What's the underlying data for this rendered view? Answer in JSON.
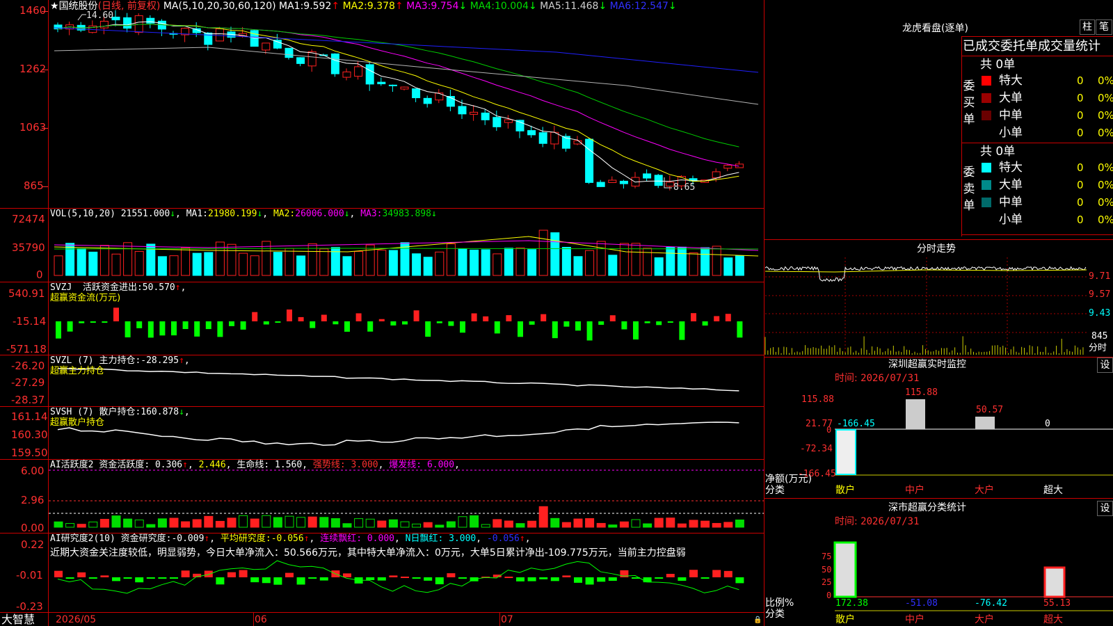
{
  "colors": {
    "up": "#ff0000",
    "down": "#00ffff",
    "ma1": "#ffffff",
    "ma2": "#ffff00",
    "ma3": "#ff00ff",
    "ma4": "#00cc00",
    "ma5": "#b4b4b4",
    "ma6": "#2020ff",
    "grid": "#cc0000",
    "axis": "#ff3030",
    "neutral": "#e0e0e0",
    "lightgreen": "#ff0000"
  },
  "header": {
    "star": "★",
    "stock": "国统股份",
    "period": "(日线, 前复权)",
    "ma_label": "MA(5,10,20,30,60,120)",
    "ma": [
      {
        "name": "MA1:",
        "value": "9.592",
        "arrow": "↑"
      },
      {
        "name": "MA2:",
        "value": "9.378",
        "arrow": "↑"
      },
      {
        "name": "MA3:",
        "value": "9.754",
        "arrow": "↓"
      },
      {
        "name": "MA4:",
        "value": "10.004",
        "arrow": "↓"
      },
      {
        "name": "MA5:",
        "value": "11.468",
        "arrow": "↓"
      },
      {
        "name": "MA6:",
        "value": "12.547",
        "arrow": "↓"
      }
    ]
  },
  "price_axis": [
    "1460",
    "1262",
    "1063",
    "865"
  ],
  "price_marks": {
    "high": "14.60",
    "low": "8.65"
  },
  "vol": {
    "label": "VOL(5,10,20)",
    "value": "21551.000",
    "arrow": "↓",
    "ma": [
      {
        "name": "MA1:",
        "value": "21980.199",
        "arrow": "↓"
      },
      {
        "name": "MA2:",
        "value": "26006.000",
        "arrow": "↓"
      },
      {
        "name": "MA3:",
        "value": "34983.898",
        "arrow": "↓"
      }
    ],
    "axis": [
      "72474",
      "35790",
      "0"
    ]
  },
  "svzj": {
    "label": "SVZJ",
    "name": "活跃资金进出:",
    "value": "50.570",
    "arrow": "↑",
    "sub": "超赢资金流(万元)",
    "axis": [
      "540.91",
      "-15.14",
      "-571.18"
    ]
  },
  "svzl": {
    "label": "SVZL (7)",
    "name": "主力持仓:",
    "value": "-28.295",
    "arrow": "↑",
    "sub": "超赢主力持仓",
    "axis": [
      "-26.20",
      "-27.29",
      "-28.37"
    ]
  },
  "svsh": {
    "label": "SVSH (7)",
    "name": "散户持仓:",
    "value": "160.878",
    "arrow": "↓",
    "sub": "超赢散户持仓",
    "axis": [
      "161.14",
      "160.30",
      "159.50"
    ]
  },
  "ai1": {
    "label": "AI活跃度2",
    "name": "资金活跃度:",
    "value": "0.306",
    "arrow": "↑",
    "v2": "2.446",
    "life": "生命线:",
    "lifev": "1.560",
    "strong": "强势线:",
    "strongv": "3.000",
    "burst": "爆发线:",
    "burstv": "6.000",
    "axis": [
      "6.00",
      "2.96",
      "0.00"
    ]
  },
  "ai2": {
    "label": "AI研究度2(10)",
    "name": "资金研究度:",
    "value": "-0.009",
    "arrow": "↑",
    "avg": "平均研究度:",
    "avgv": "-0.056",
    "arrow2": "↑",
    "red": "连续飘红:",
    "redv": "0.000",
    "nred": "N日飘红:",
    "nredv": "3.000",
    "last": "-0.056",
    "arrow3": "↑",
    "comment": "近期大资金关注度较低，明显弱势，今日大单净流入：50.566万元，其中特大单净流入：0万元，大单5日累计净出-109.775万元，当前主力控盘弱",
    "axis": [
      "0.22",
      "-0.01",
      "-0.23"
    ]
  },
  "footer": {
    "brand": "大智慧",
    "dates": [
      "2026/05",
      "06",
      "07"
    ]
  },
  "right": {
    "lhb_title": "龙虎看盘(逐单)",
    "btn1": "柱",
    "btn2": "笔",
    "tabs": [
      "已成交",
      "委托单",
      "成交量统计"
    ],
    "buy": {
      "label": "委\n买\n单",
      "total": "共 0单",
      "rows": [
        {
          "n": "特大",
          "v": "0",
          "p": "0%",
          "c": "#ff0000"
        },
        {
          "n": "大单",
          "v": "0",
          "p": "0%",
          "c": "#9a0000"
        },
        {
          "n": "中单",
          "v": "0",
          "p": "0%",
          "c": "#6a0000"
        },
        {
          "n": "小单",
          "v": "0",
          "p": "0%",
          "c": "#000000"
        }
      ]
    },
    "sell": {
      "label": "委\n卖\n单",
      "total": "共 0单",
      "rows": [
        {
          "n": "特大",
          "v": "0",
          "p": "0%",
          "c": "#00ffff"
        },
        {
          "n": "大单",
          "v": "0",
          "p": "0%",
          "c": "#008a8a"
        },
        {
          "n": "中单",
          "v": "0",
          "p": "0%",
          "c": "#006a6a"
        },
        {
          "n": "小单",
          "v": "0",
          "p": "0%",
          "c": "#000000"
        }
      ]
    },
    "fs_title": "分时走势",
    "fs_axis": [
      "9.71",
      "9.57",
      "9.43"
    ],
    "fs_vol": "845",
    "fs_label": "分时",
    "sz_title": "深圳超赢实时监控",
    "set": "设",
    "time_label": "时间:",
    "time": "2026/07/31",
    "sz_axis": [
      "115.88",
      "21.77",
      "0",
      "-72.34",
      "-166.45"
    ],
    "sz_bars": [
      {
        "v": "-166.45"
      },
      {
        "v": "115.88"
      },
      {
        "v": "50.57"
      },
      {
        "v": "0"
      }
    ],
    "net_label": "净额(万元)",
    "cls_label": "分类",
    "cats": [
      "散户",
      "中户",
      "大户",
      "超大"
    ],
    "sc_title": "深市超赢分类统计",
    "sc_axis": [
      "75",
      "50",
      "25",
      "0"
    ],
    "sc_vals": [
      "172.38",
      "-51.08",
      "-76.42",
      "55.13"
    ],
    "ratio_label": "比例%"
  }
}
